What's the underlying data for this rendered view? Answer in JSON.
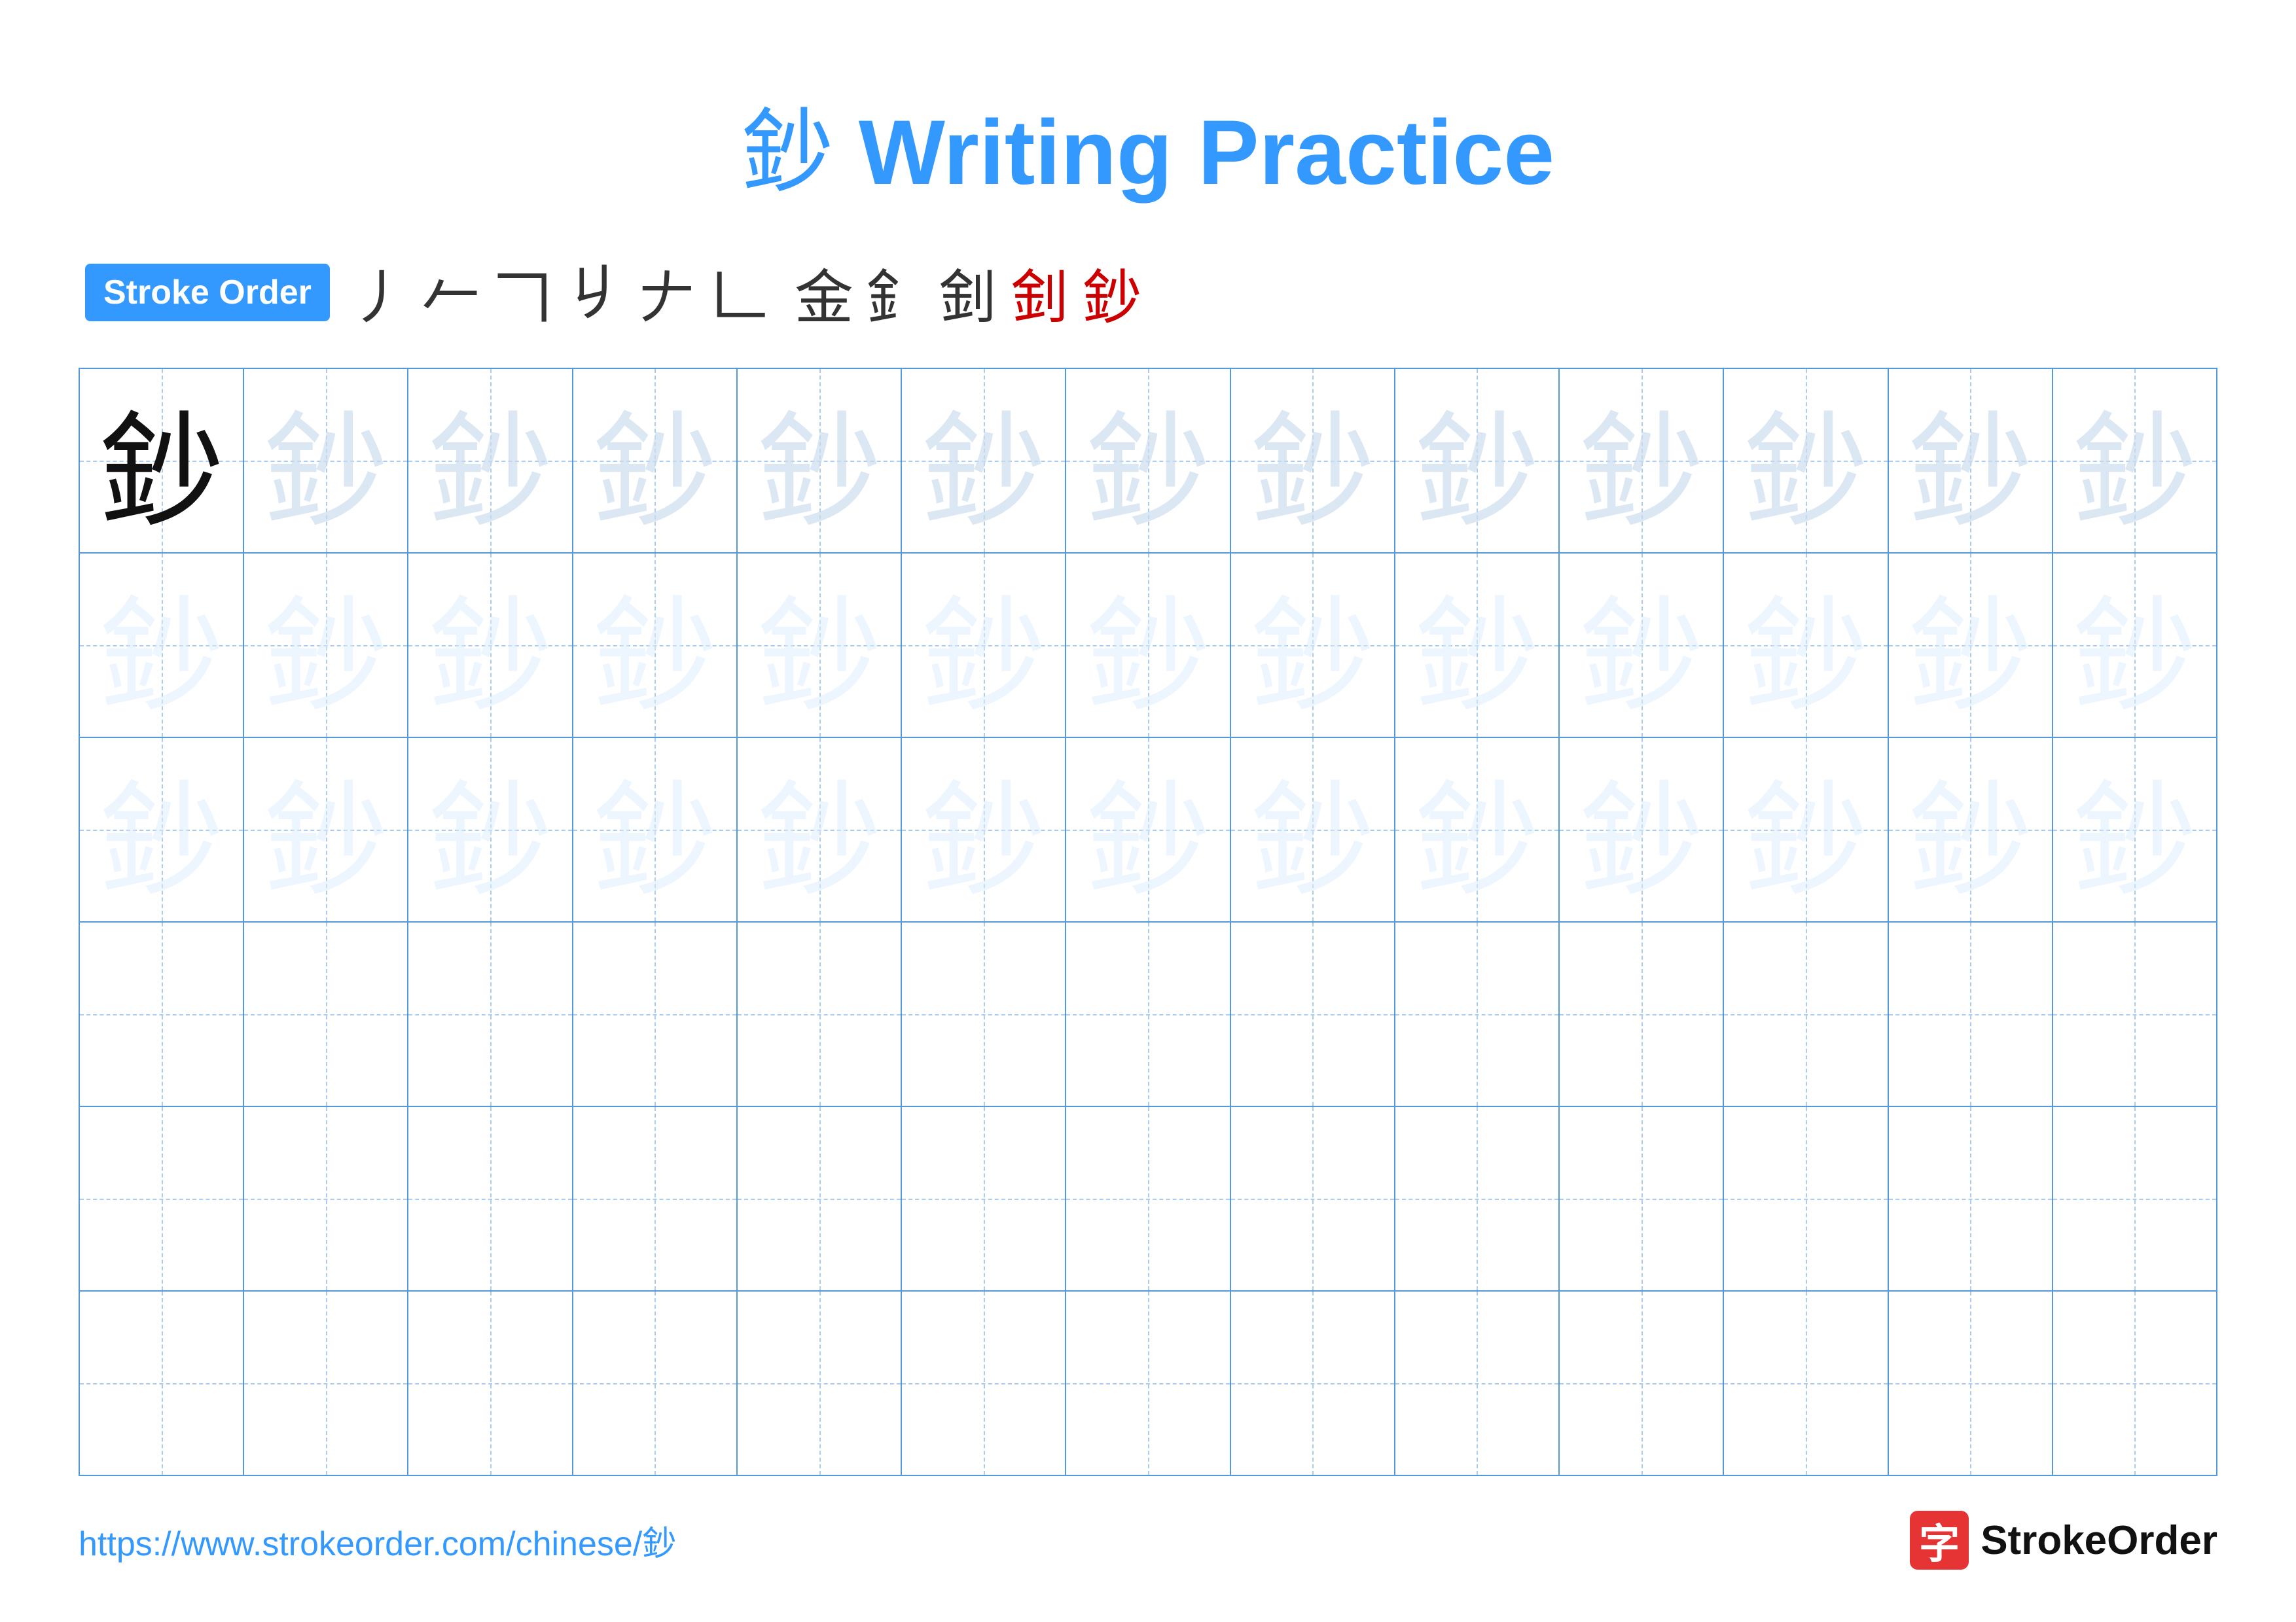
{
  "title": {
    "char": "鈔",
    "text": " Writing Practice"
  },
  "stroke_order": {
    "badge_label": "Stroke Order",
    "strokes": [
      "丿",
      "丿",
      "𠂉",
      "𠃍",
      "𠂇",
      "𠃍",
      "𠃊",
      "金",
      "釒",
      "釒",
      "釒",
      "鈔"
    ]
  },
  "grid": {
    "char": "鈔",
    "rows": 6,
    "cols": 13,
    "row_types": [
      "dark_then_light",
      "lighter",
      "lighter",
      "empty",
      "empty",
      "empty"
    ]
  },
  "footer": {
    "url": "https://www.strokeorder.com/chinese/鈔",
    "logo_char": "字",
    "logo_name": "StrokeOrder"
  }
}
